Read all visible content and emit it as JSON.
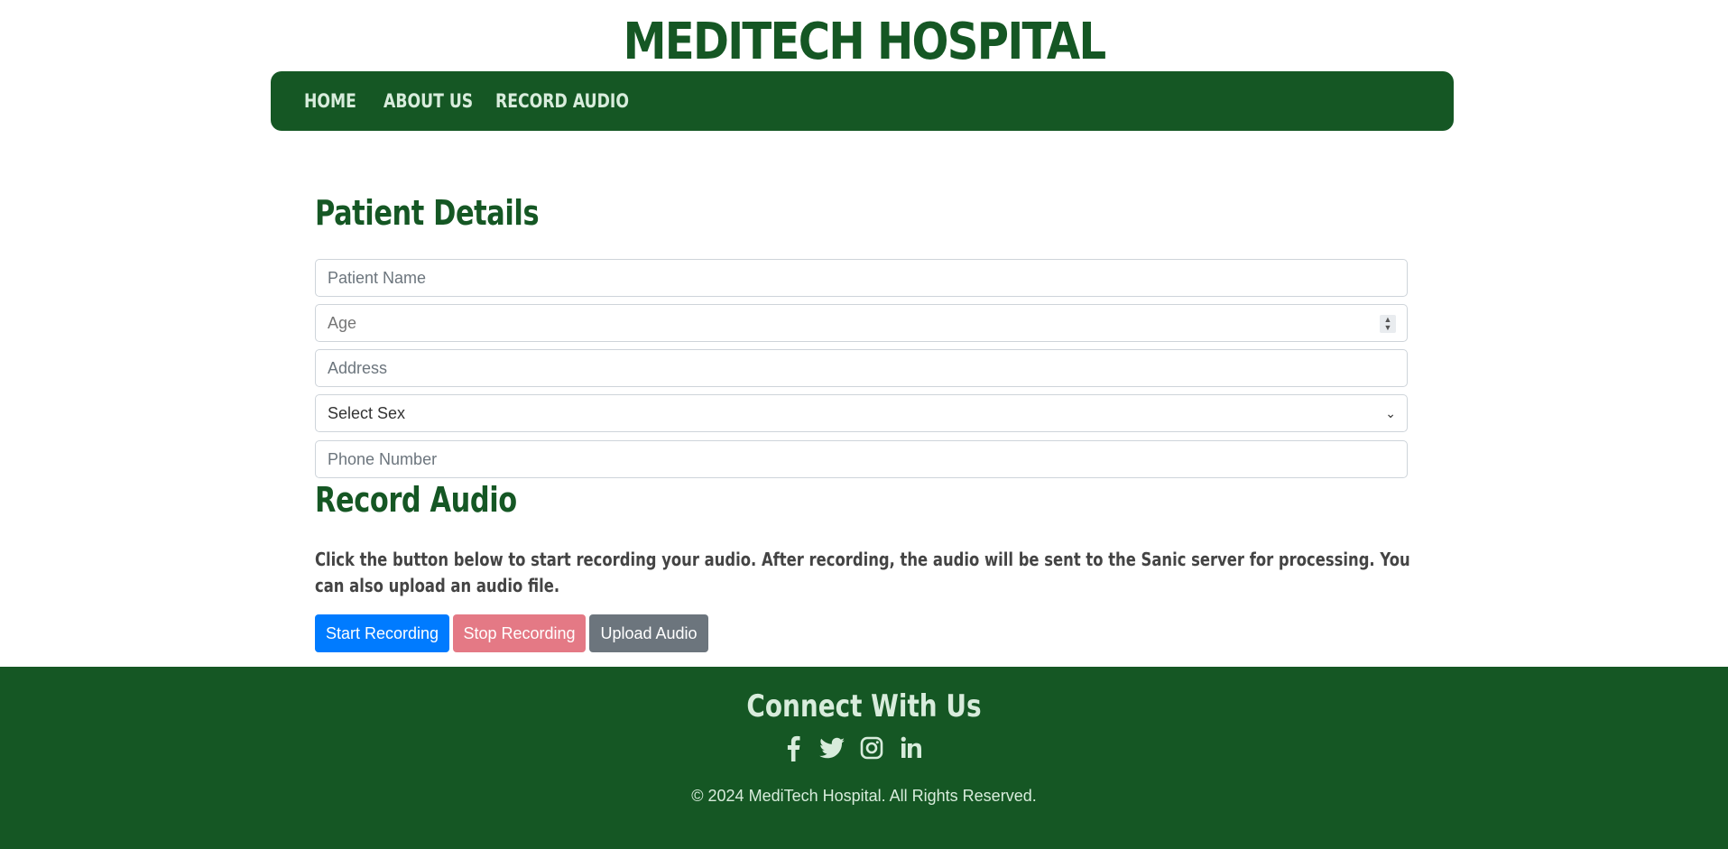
{
  "header": {
    "title": "MEDITECH HOSPITAL"
  },
  "nav": {
    "items": [
      {
        "label": "HOME"
      },
      {
        "label": "ABOUT US"
      },
      {
        "label": "RECORD AUDIO"
      }
    ]
  },
  "patient": {
    "heading": "Patient Details",
    "name_placeholder": "Patient Name",
    "age_placeholder": "Age",
    "address_placeholder": "Address",
    "sex_selected": "Select Sex",
    "phone_placeholder": "Phone Number"
  },
  "record": {
    "heading": "Record Audio",
    "description": "Click the button below to start recording your audio. After recording, the audio will be sent to the Sanic server for processing. You can also upload an audio file.",
    "start_label": "Start Recording",
    "stop_label": "Stop Recording",
    "upload_label": "Upload Audio"
  },
  "footer": {
    "heading": "Connect With Us",
    "social_icons": [
      "facebook-icon",
      "twitter-icon",
      "instagram-icon",
      "linkedin-icon"
    ],
    "copyright": "© 2024 MediTech Hospital. All Rights Reserved."
  },
  "colors": {
    "brand_green": "#155724",
    "nav_text": "#d8ecdc",
    "start_button": "#007bff",
    "stop_button": "#e47985",
    "upload_button": "#6c757d"
  }
}
